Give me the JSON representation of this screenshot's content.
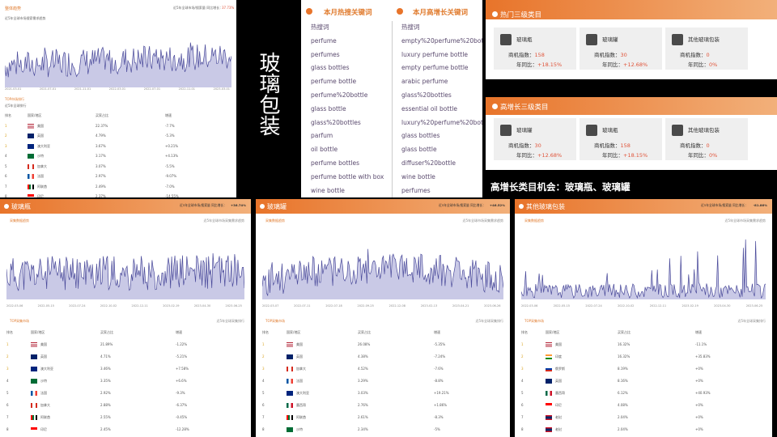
{
  "panel_top_left": {
    "title": "整体趋势",
    "meta": "近5年全球市场/搜索量    同比增长：",
    "meta_value": "37.73%",
    "subtitle": "近5年全球市场搜索需求趋势",
    "x_ticks": [
      "2021-03-01",
      "2021-07-01",
      "2021-11-01",
      "2022-03-01",
      "2022-07-01",
      "2022-11-01",
      "2023-03-01"
    ],
    "table_title": "TOP市场排行",
    "table_subtitle": "近5年全球排行",
    "columns": [
      "排名",
      "国家/地区",
      "买家占比",
      "增速"
    ],
    "rows": [
      {
        "rank": "1",
        "country": "美国",
        "share": "22.37%",
        "growth": "-7.7%",
        "flag": "us"
      },
      {
        "rank": "2",
        "country": "英国",
        "share": "4.79%",
        "growth": "-5.3%",
        "flag": "uk"
      },
      {
        "rank": "3",
        "country": "澳大利亚",
        "share": "3.67%",
        "growth": "+0.21%",
        "flag": "au"
      },
      {
        "rank": "4",
        "country": "沙特",
        "share": "3.17%",
        "growth": "+4.13%",
        "flag": "sa"
      },
      {
        "rank": "5",
        "country": "加拿大",
        "share": "3.07%",
        "growth": "-5.5%",
        "flag": "ca"
      },
      {
        "rank": "6",
        "country": "法国",
        "share": "2.97%",
        "growth": "-9.07%",
        "flag": "fr"
      },
      {
        "rank": "7",
        "country": "阿联酋",
        "share": "2.49%",
        "growth": "-7.0%",
        "flag": "ae"
      },
      {
        "rank": "8",
        "country": "印尼",
        "share": "2.37%",
        "growth": "-14.55%",
        "flag": "id"
      }
    ]
  },
  "vertical_title": "玻璃包装",
  "hot_keywords": {
    "title": "本月热搜关键词",
    "header": "热搜词",
    "items": [
      "perfume",
      "perfumes",
      "glass bottles",
      "perfume bottle",
      "perfume%20bottle",
      "glass bottle",
      "glass%20bottles",
      "parfum",
      "oil bottle",
      "perfume bottles",
      "perfume bottle with box",
      "wine bottle"
    ]
  },
  "growth_keywords": {
    "title": "本月高增长关键词",
    "header": "热搜词",
    "items": [
      "empty%20perfume%20bottle",
      "luxury perfume bottle",
      "empty perfume bottle",
      "arabic perfume",
      "glass%20bottles",
      "essential oil bottle",
      "luxury%20perfume%20bottle",
      "glass bottles",
      "glass bottle",
      "diffuser%20bottle",
      "wine bottle",
      "perfumes"
    ]
  },
  "hot_categories": {
    "title": "热门三级类目",
    "cards": [
      {
        "name": "玻璃瓶",
        "label1": "商机指数：",
        "value1": "158",
        "label2": "年同比：",
        "value2": "+18.15%"
      },
      {
        "name": "玻璃罐",
        "label1": "商机指数：",
        "value1": "30",
        "label2": "年同比：",
        "value2": "+12.68%"
      },
      {
        "name": "其他玻璃包装",
        "label1": "商机指数：",
        "value1": "0",
        "label2": "年同比：",
        "value2": "0%"
      }
    ]
  },
  "growth_categories": {
    "title": "高增长三级类目",
    "cards": [
      {
        "name": "玻璃罐",
        "label1": "商机指数：",
        "value1": "30",
        "label2": "年同比：",
        "value2": "+12.68%"
      },
      {
        "name": "玻璃瓶",
        "label1": "商机指数：",
        "value1": "158",
        "label2": "年同比：",
        "value2": "+18.15%"
      },
      {
        "name": "其他玻璃包装",
        "label1": "商机指数：",
        "value1": "0",
        "label2": "年同比：",
        "value2": "0%"
      }
    ]
  },
  "opportunity_text": "高增长类目机会：玻璃瓶、玻璃罐",
  "bottom_panels": [
    {
      "title": "玻璃瓶",
      "meta": "近5年全球市场/搜索量  同比增长：",
      "meta_value": "+36.74%",
      "sub_left": "采集数据趋势",
      "sub_right": "近5年全球市场采集需求趋势",
      "x_ticks": [
        "2022-03-06",
        "2022-05-15",
        "2022-07-24",
        "2022-10-02",
        "2022-12-11",
        "2023-02-19",
        "2023-04-30",
        "2023-06-25"
      ],
      "table_title": "TOP采集市场",
      "table_subtitle": "近5年全球采集排行",
      "columns": [
        "排名",
        "国家/地区",
        "买家占比",
        "增速"
      ],
      "rows": [
        {
          "rank": "1",
          "country": "美国",
          "share": "21.89%",
          "growth": "-1.22%",
          "flag": "us"
        },
        {
          "rank": "2",
          "country": "英国",
          "share": "4.71%",
          "growth": "-5.21%",
          "flag": "uk"
        },
        {
          "rank": "3",
          "country": "澳大利亚",
          "share": "3.46%",
          "growth": "+7.58%",
          "flag": "au"
        },
        {
          "rank": "4",
          "country": "沙特",
          "share": "3.35%",
          "growth": "+6.6%",
          "flag": "sa"
        },
        {
          "rank": "5",
          "country": "法国",
          "share": "2.92%",
          "growth": "-9.3%",
          "flag": "fr"
        },
        {
          "rank": "6",
          "country": "加拿大",
          "share": "2.88%",
          "growth": "-6.37%",
          "flag": "ca"
        },
        {
          "rank": "7",
          "country": "阿联酋",
          "share": "2.55%",
          "growth": "-0.45%",
          "flag": "ae"
        },
        {
          "rank": "8",
          "country": "印尼",
          "share": "2.45%",
          "growth": "-12.28%",
          "flag": "id"
        }
      ]
    },
    {
      "title": "玻璃罐",
      "meta": "近5年全球市场/搜索量  同比增长：",
      "meta_value": "+46.52%",
      "sub_left": "采集数据趋势",
      "sub_right": "近5年全球市场采集需求趋势",
      "x_ticks": [
        "2022-03-07",
        "2022-07-11",
        "2022-07-18",
        "2022-09-25",
        "2022-12-08",
        "2023-02-13",
        "2023-04-21",
        "2023-06-26"
      ],
      "table_title": "TOP采集市场",
      "table_subtitle": "近5年全球采集排行",
      "columns": [
        "排名",
        "国家/地区",
        "买家占比",
        "增速"
      ],
      "rows": [
        {
          "rank": "1",
          "country": "美国",
          "share": "26.08%",
          "growth": "-5.35%",
          "flag": "us"
        },
        {
          "rank": "2",
          "country": "英国",
          "share": "4.38%",
          "growth": "-7.24%",
          "flag": "uk"
        },
        {
          "rank": "3",
          "country": "加拿大",
          "share": "4.52%",
          "growth": "-7.6%",
          "flag": "ca"
        },
        {
          "rank": "4",
          "country": "法国",
          "share": "3.29%",
          "growth": "-8.8%",
          "flag": "fr"
        },
        {
          "rank": "5",
          "country": "澳大利亚",
          "share": "3.03%",
          "growth": "+19.21%",
          "flag": "au"
        },
        {
          "rank": "6",
          "country": "墨西哥",
          "share": "2.76%",
          "growth": "+1.86%",
          "flag": "mx"
        },
        {
          "rank": "7",
          "country": "阿联酋",
          "share": "2.61%",
          "growth": "-8.3%",
          "flag": "ae"
        },
        {
          "rank": "8",
          "country": "沙特",
          "share": "2.34%",
          "growth": "-5%",
          "flag": "sa"
        }
      ]
    },
    {
      "title": "其他玻璃包装",
      "meta": "近5年全球市场/搜索量  同比增长：",
      "meta_value": "-81.86%",
      "sub_left": "采集数据趋势",
      "sub_right": "近5年全球市场采集需求趋势",
      "x_ticks": [
        "2022-03-06",
        "2022-05-15",
        "2022-07-24",
        "2022-10-02",
        "2022-12-11",
        "2023-02-19",
        "2023-04-30",
        "2023-06-25"
      ],
      "table_title": "TOP采集市场",
      "table_subtitle": "近5年全球采集排行",
      "columns": [
        "排名",
        "国家/地区",
        "买家占比",
        "增速"
      ],
      "rows": [
        {
          "rank": "1",
          "country": "美国",
          "share": "16.32%",
          "growth": "-11.1%",
          "flag": "us"
        },
        {
          "rank": "2",
          "country": "印度",
          "share": "16.32%",
          "growth": "+35.83%",
          "flag": "in"
        },
        {
          "rank": "3",
          "country": "俄罗斯",
          "share": "8.19%",
          "growth": "+0%",
          "flag": "ru"
        },
        {
          "rank": "4",
          "country": "英国",
          "share": "8.16%",
          "growth": "+0%",
          "flag": "uk"
        },
        {
          "rank": "5",
          "country": "墨西哥",
          "share": "6.12%",
          "growth": "+40.93%",
          "flag": "mx"
        },
        {
          "rank": "6",
          "country": "印尼",
          "share": "4.08%",
          "growth": "+0%",
          "flag": "id"
        },
        {
          "rank": "7",
          "country": "老挝",
          "share": "2.04%",
          "growth": "+0%",
          "flag": "la"
        },
        {
          "rank": "8",
          "country": "老挝",
          "share": "2.04%",
          "growth": "+0%",
          "flag": "la"
        }
      ]
    }
  ],
  "colors": {
    "accent": "#e8742a",
    "line": "#5050a0",
    "fill": "#c9c9e6",
    "up": "#e0543a"
  }
}
